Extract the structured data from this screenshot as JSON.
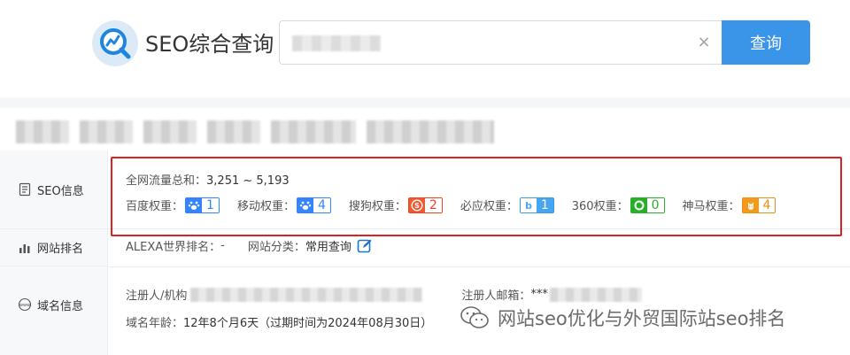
{
  "header": {
    "brand": "SEO综合查询",
    "search": {
      "value": "",
      "placeholder": ""
    },
    "search_button": "查询"
  },
  "sidebar": {
    "items": [
      {
        "label": "SEO信息",
        "icon": "document-icon"
      },
      {
        "label": "网站排名",
        "icon": "bar-chart-icon"
      },
      {
        "label": "域名信息",
        "icon": "www-globe-icon"
      }
    ]
  },
  "seo": {
    "traffic_label": "全网流量总和：",
    "traffic_value": "3,251 ~ 5,193",
    "weights": [
      {
        "label": "百度权重：",
        "value": "1",
        "icon": "baidu-paw-icon",
        "color": "#3385ff",
        "icon_color": "#3385ff"
      },
      {
        "label": "移动权重：",
        "value": "4",
        "icon": "baidu-paw-icon",
        "color": "#3385ff",
        "icon_color": "#3385ff"
      },
      {
        "label": "搜狗权重：",
        "value": "2",
        "icon": "sogou-s-icon",
        "color": "#ee4422",
        "icon_color": "#f05a30"
      },
      {
        "label": "必应权重：",
        "value": "1",
        "icon": "bing-b-icon",
        "color": "#3a9ae8",
        "icon_color": "#47a6ef"
      },
      {
        "label": "360权重：",
        "value": "0",
        "icon": "360-ring-icon",
        "color": "#2bb02b",
        "icon_color": "#25b025"
      },
      {
        "label": "神马权重：",
        "value": "4",
        "icon": "shenma-horse-icon",
        "color": "#f08c10",
        "icon_color": "#f49a1a"
      }
    ]
  },
  "ranking": {
    "alexa_label": "ALEXA世界排名：",
    "alexa_value": "-",
    "category_label": "网站分类：",
    "category_value": "常用查询"
  },
  "domain": {
    "registrant_label": "注册人/机构",
    "email_label": "注册人邮箱：",
    "email_value": "***",
    "age_label": "域名年龄：",
    "age_value": "12年8个月6天（过期时间为2024年08月30日）"
  },
  "watermark": {
    "text": "网站seo优化与外贸国际站seo排名"
  },
  "colors": {
    "accent": "#3a94e8",
    "highlight_border": "#e02020"
  }
}
